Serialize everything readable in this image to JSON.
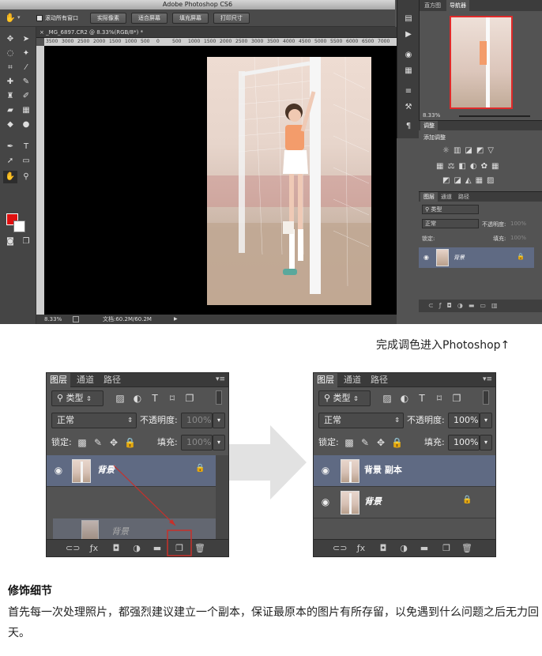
{
  "photoshop": {
    "app_title": "Adobe Photoshop CS6",
    "options_bar": {
      "scroll_all_windows": "滚动所有窗口",
      "actual_pixels": "实际像素",
      "fit_screen": "适合屏幕",
      "fill_screen": "填充屏幕",
      "print_size": "打印尺寸"
    },
    "document_tab": "_MG_6897.CR2 @ 8.33%(RGB/8*) *",
    "ruler_ticks": [
      "3500",
      "3000",
      "2500",
      "2000",
      "1500",
      "1000",
      "500",
      "0",
      "500",
      "1000",
      "1500",
      "2000",
      "2500",
      "3000",
      "3500",
      "4000",
      "4500",
      "5000",
      "5500",
      "6000",
      "6500",
      "7000"
    ],
    "status": {
      "zoom": "8.33%",
      "doc_size": "文档:60.2M/60.2M"
    },
    "panels": {
      "histogram_tab": "直方图",
      "navigator_tab": "导航器",
      "navigator_zoom": "8.33%",
      "adjustments_tab": "调整",
      "add_adjustment": "添加调整",
      "layers_tab": "图层",
      "channels_tab": "通道",
      "paths_tab": "路径",
      "kind_label": "类型",
      "blend_mode": "正常",
      "opacity_label": "不透明度:",
      "opacity_value": "100%",
      "lock_label": "锁定:",
      "fill_label": "填充:",
      "fill_value": "100%",
      "layer_name": "背景"
    }
  },
  "caption": "完成调色进入Photoshop↑",
  "left_layers_panel": {
    "tabs": [
      "图层",
      "通道",
      "路径"
    ],
    "kind_label": "类型",
    "blend_mode": "正常",
    "opacity_label": "不透明度:",
    "opacity_value": "100%",
    "lock_label": "锁定:",
    "fill_label": "填充:",
    "fill_value": "100%",
    "layers": [
      {
        "name": "背景"
      }
    ],
    "drag_ghost_name": "背景",
    "highlight_color": "#c8302a"
  },
  "right_layers_panel": {
    "tabs": [
      "图层",
      "通道",
      "路径"
    ],
    "kind_label": "类型",
    "blend_mode": "正常",
    "opacity_label": "不透明度:",
    "opacity_value": "100%",
    "lock_label": "锁定:",
    "fill_label": "填充:",
    "fill_value": "100%",
    "layers": [
      {
        "name": "背景 副本"
      },
      {
        "name": "背景"
      }
    ]
  },
  "section": {
    "title": "修饰细节",
    "body": "首先每一次处理照片，都强烈建议建立一个副本，保证最原本的图片有所存留，以免遇到什么问题之后无力回天。"
  },
  "colors": {
    "panel_bg": "#535353",
    "selection": "#5f6a83",
    "foreground_swatch": "#e01010",
    "arrow": "#e2e2e2"
  }
}
